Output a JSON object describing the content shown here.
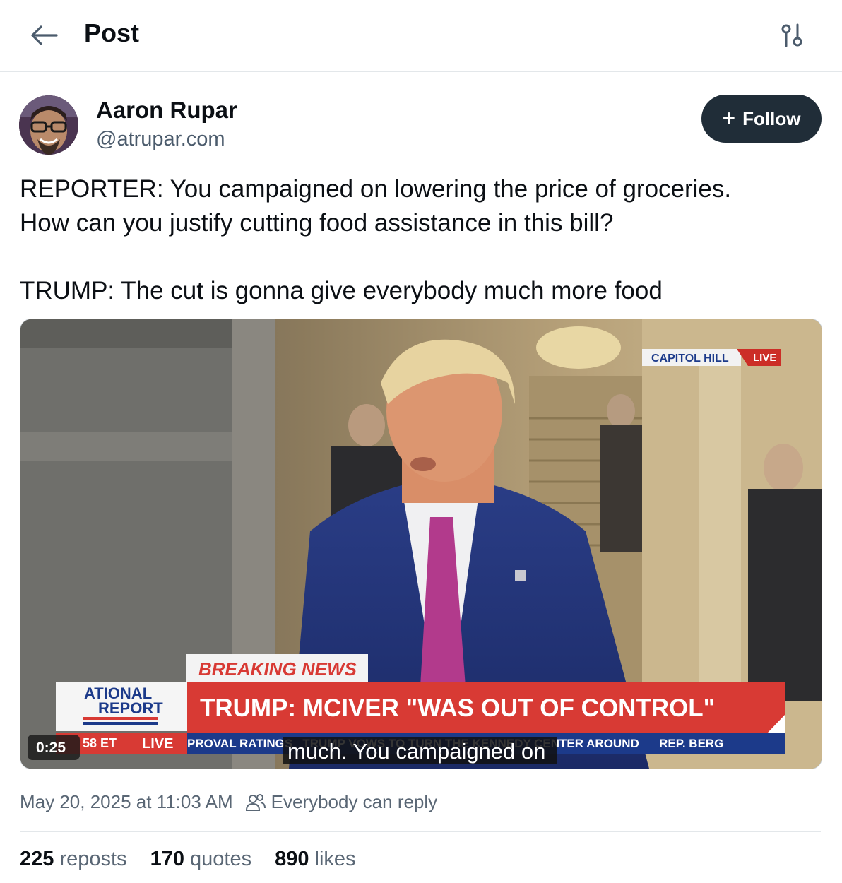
{
  "header": {
    "title": "Post",
    "back_icon": "arrow-left-icon",
    "settings_icon": "sliders-icon"
  },
  "author": {
    "name": "Aaron Rupar",
    "handle": "@atrupar.com"
  },
  "follow": {
    "plus": "+",
    "label": "Follow"
  },
  "post": {
    "line1": "REPORTER: You campaigned on lowering the price of groceries.",
    "line2": "How can you justify cutting food assistance in this bill?",
    "line3": "TRUMP: The cut is gonna give everybody much more food"
  },
  "video": {
    "time": "0:25",
    "caption": "much. You campaigned on",
    "bug_location": "CAPITOL HILL",
    "bug_live": "LIVE",
    "breaking": "BREAKING NEWS",
    "headline": "TRUMP: MCIVER \"WAS OUT OF CONTROL\"",
    "logo_line1": "ATIONAL",
    "logo_line2": "REPORT",
    "ticker_time": "58 ET",
    "ticker_live": "LIVE",
    "ticker_text": "PROVAL RATINGS   TRUMP VOWS TO TURN THE KENNEDY CENTER AROUND      REP. BERG"
  },
  "meta": {
    "timestamp": "May 20, 2025 at 11:03 AM",
    "reply_setting": "Everybody can reply"
  },
  "stats": {
    "reposts_count": "225",
    "reposts_label": "reposts",
    "quotes_count": "170",
    "quotes_label": "quotes",
    "likes_count": "890",
    "likes_label": "likes"
  },
  "colors": {
    "follow_bg": "#202d38",
    "handle": "#4b5b6c",
    "breaking_red": "#d83a34",
    "chyron_navy": "#1c3a8a"
  }
}
